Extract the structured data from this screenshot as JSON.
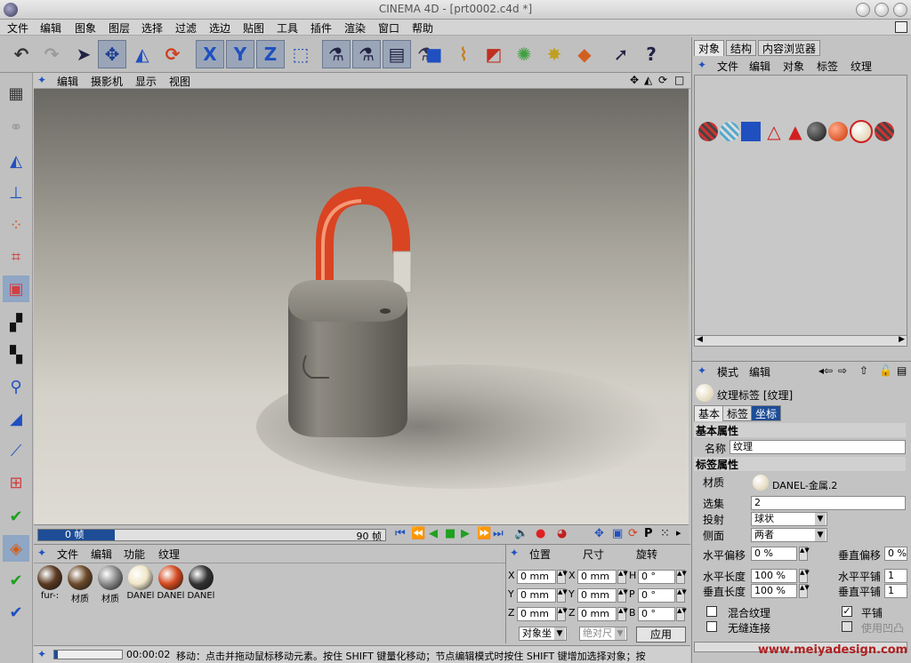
{
  "window": {
    "title": "CINEMA 4D - [prt0002.c4d *]"
  },
  "menubar": {
    "items": [
      "文件",
      "编辑",
      "图象",
      "图层",
      "选择",
      "过滤",
      "选边",
      "贴图",
      "工具",
      "插件",
      "渲染",
      "窗口",
      "帮助"
    ]
  },
  "toolbar": {
    "icons": [
      "undo-icon",
      "redo-icon",
      "select-arrow-icon",
      "move-icon",
      "scale-icon",
      "rotate-icon",
      "x-axis-icon",
      "y-axis-icon",
      "z-axis-icon",
      "world-coord-icon",
      "render-view-icon",
      "render-pic-icon",
      "render-settings-icon",
      "render-queue-icon",
      "cube-icon",
      "spline-icon",
      "nurbs-icon",
      "deformer-icon",
      "light-icon",
      "tag-icon",
      "cursor-help-icon",
      "help-icon"
    ],
    "axis_labels": {
      "x": "X",
      "y": "Y",
      "z": "Z"
    }
  },
  "viewport": {
    "menu": [
      "编辑",
      "摄影机",
      "显示",
      "视图"
    ]
  },
  "timeline": {
    "current_frame": "0 帧",
    "end_frame": "90 帧"
  },
  "materials": {
    "menu": [
      "文件",
      "编辑",
      "功能",
      "纹理"
    ],
    "items": [
      {
        "label": "fur-:",
        "color": "#5a3a22"
      },
      {
        "label": "材质",
        "color": "#6b4a2a"
      },
      {
        "label": "材质",
        "color": "#8a8a8a"
      },
      {
        "label": "DANEl",
        "color": "#f0e6c8"
      },
      {
        "label": "DANEl",
        "color": "#d44a20"
      },
      {
        "label": "DANEl",
        "color": "#333333"
      }
    ]
  },
  "coords": {
    "headers": [
      "位置",
      "尺寸",
      "旋转"
    ],
    "rows": [
      {
        "pos_axis": "X",
        "pos": "0 mm",
        "size_axis": "X",
        "size": "0 mm",
        "rot_axis": "H",
        "rot": "0 °"
      },
      {
        "pos_axis": "Y",
        "pos": "0 mm",
        "size_axis": "Y",
        "size": "0 mm",
        "rot_axis": "P",
        "rot": "0 °"
      },
      {
        "pos_axis": "Z",
        "pos": "0 mm",
        "size_axis": "Z",
        "size": "0 mm",
        "rot_axis": "B",
        "rot": "0 °"
      }
    ],
    "mode_select": "对象坐",
    "size_select": "绝对尺",
    "apply_label": "应用"
  },
  "status": {
    "time": "00:00:02",
    "message": "移动：点击并拖动鼠标移动元素。按住 SHIFT 键量化移动；节点编辑模式时按住 SHIFT 键增加选择对象；按"
  },
  "object_manager": {
    "tabs": [
      "对象",
      "结构",
      "内容浏览器"
    ],
    "menu": [
      "文件",
      "编辑",
      "对象",
      "标签",
      "纹理"
    ]
  },
  "attributes": {
    "menu": [
      "模式",
      "编辑"
    ],
    "header": "纹理标签 [纹理]",
    "tabs": [
      "基本",
      "标签",
      "坐标"
    ],
    "basic_title": "基本属性",
    "name_label": "名称",
    "name_value": "纹理",
    "tag_title": "标签属性",
    "material_label": "材质",
    "material_value": "DANEL-金属.2",
    "selection_label": "选集",
    "selection_value": "2",
    "projection_label": "投射",
    "projection_value": "球状",
    "side_label": "侧面",
    "side_value": "两者",
    "offset_u_label": "水平偏移",
    "offset_u": "0 %",
    "offset_v_label": "垂直偏移",
    "offset_v": "0 %",
    "length_u_label": "水平长度",
    "length_u": "100 %",
    "tiles_u_label": "水平平铺",
    "tiles_u": "1",
    "length_v_label": "垂直长度",
    "length_v": "100 %",
    "tiles_v_label": "垂直平铺",
    "tiles_v": "1",
    "mix_label": "混合纹理",
    "tile_label": "平铺",
    "seamless_label": "无缝连接",
    "bump_label": "使用凹凸"
  },
  "watermark": "www.meiyadesign.com"
}
